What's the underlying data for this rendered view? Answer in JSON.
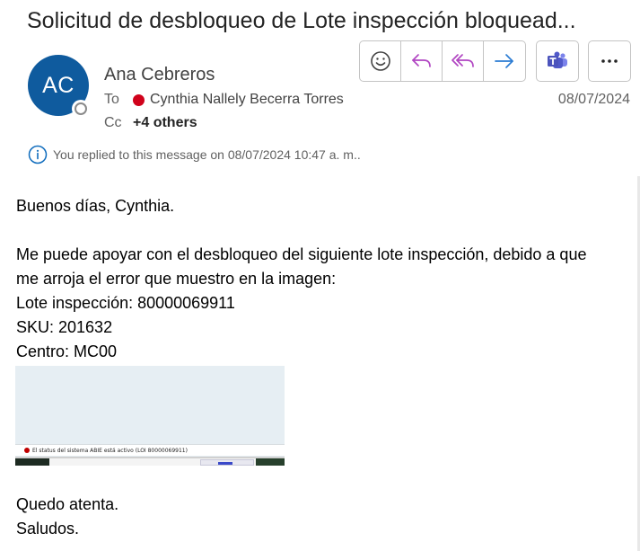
{
  "header": {
    "subject": "Solicitud de desbloqueo de Lote inspección bloquead...",
    "avatar_initials": "AC",
    "sender_name": "Ana Cebreros",
    "to_label": "To",
    "to_recipient": "Cynthia Nallely Becerra Torres",
    "cc_label": "Cc",
    "cc_others": "+4 others",
    "date": "08/07/2024",
    "replied_notice": "You replied to this message on 08/07/2024 10:47 a. m.."
  },
  "toolbar": {
    "buttons": [
      {
        "name": "emoji-react",
        "icon": "smiley-icon"
      },
      {
        "name": "reply",
        "icon": "reply-arrow-icon"
      },
      {
        "name": "reply-all",
        "icon": "reply-all-arrow-icon"
      },
      {
        "name": "forward",
        "icon": "forward-arrow-icon"
      },
      {
        "name": "share-to-teams",
        "icon": "teams-icon"
      },
      {
        "name": "more-actions",
        "icon": "ellipsis-icon"
      }
    ]
  },
  "colors": {
    "avatar_bg": "#0f5b9e",
    "presence_busy": "#d0021b",
    "reply_icon": "#b146c2",
    "forward_icon": "#2b7cd3",
    "teams": "#5059c9"
  },
  "body": {
    "greeting": "Buenos días, Cynthia.",
    "line1": "Me puede apoyar con el desbloqueo del siguiente lote inspección, debido a que",
    "line2": "me arroja el error que muestro en la imagen:",
    "lote": "Lote inspección: 80000069911",
    "sku": "SKU: 201632",
    "centro": "Centro: MC00",
    "image_status_text": "El status del sistema ABIE está activo (LOI 80000069911)",
    "closing1": "Quedo atenta.",
    "closing2": "Saludos."
  }
}
